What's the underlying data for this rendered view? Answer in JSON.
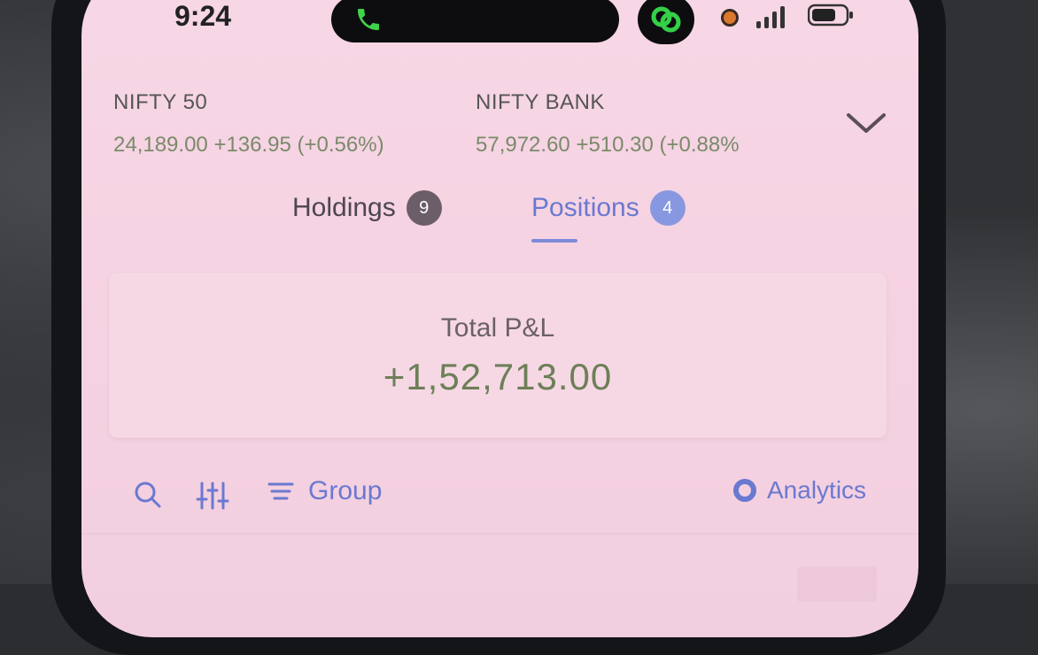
{
  "status_bar": {
    "time": "9:24"
  },
  "indices": [
    {
      "name": "NIFTY 50",
      "values": "24,189.00 +136.95 (+0.56%)"
    },
    {
      "name": "NIFTY BANK",
      "values": "57,972.60 +510.30 (+0.88%"
    }
  ],
  "tabs": [
    {
      "label": "Holdings",
      "count": "9",
      "active": false
    },
    {
      "label": "Positions",
      "count": "4",
      "active": true
    }
  ],
  "pnl": {
    "label": "Total P&L",
    "value": "+1,52,713.00"
  },
  "toolbar": {
    "search_icon": "search-icon",
    "filter_icon": "filter-sliders-icon",
    "group_label": "Group",
    "analytics_label": "Analytics"
  },
  "colors": {
    "background": "#f6d3e2",
    "accent": "#6a79d0",
    "profit": "#6d7f57"
  }
}
